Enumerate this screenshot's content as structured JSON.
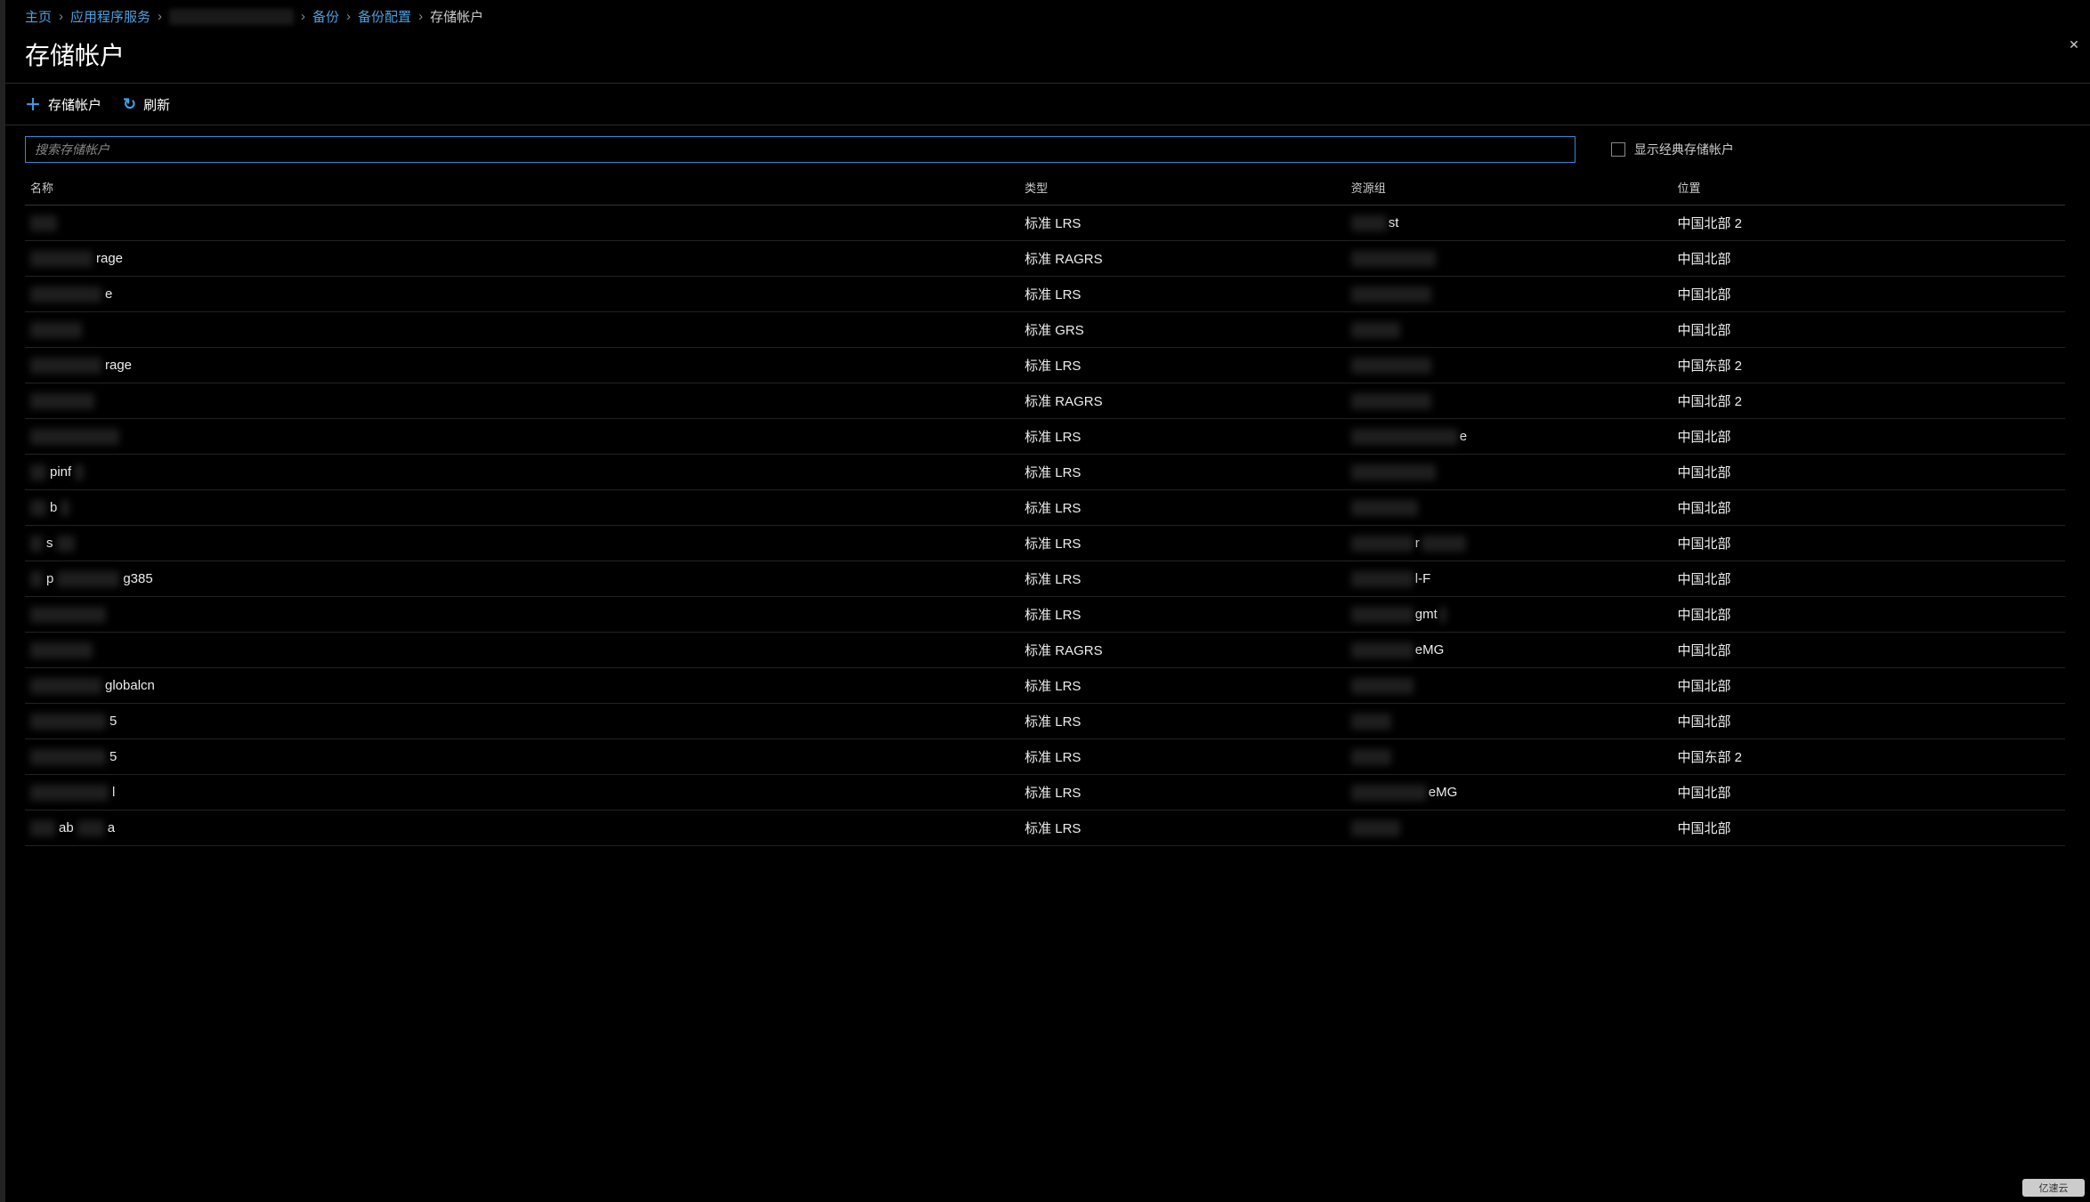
{
  "breadcrumb": {
    "home": "主页",
    "app_services": "应用程序服务",
    "backup": "备份",
    "backup_config": "备份配置",
    "storage_account": "存储帐户"
  },
  "page_title": "存储帐户",
  "close_label": "✕",
  "toolbar": {
    "add_storage": "存储帐户",
    "refresh": "刷新"
  },
  "search": {
    "placeholder": "搜索存储帐户"
  },
  "checkbox": {
    "show_classic": "显示经典存储帐户"
  },
  "columns": {
    "name": "名称",
    "type": "类型",
    "resource_group": "资源组",
    "location": "位置"
  },
  "rows": [
    {
      "name_suffix": "",
      "blur_w": 30,
      "type": "标准 LRS",
      "group_suffix": "st",
      "group_blur_w": 40,
      "location": "中国北部 2"
    },
    {
      "name_suffix": "rage",
      "blur_w": 70,
      "type": "标准 RAGRS",
      "group_suffix": "",
      "group_blur_w": 95,
      "location": "中国北部"
    },
    {
      "name_suffix": "",
      "blur_w": 80,
      "name_extra": "e",
      "type": "标准 LRS",
      "group_suffix": "",
      "group_blur_w": 90,
      "location": "中国北部"
    },
    {
      "name_suffix": "",
      "blur_w": 58,
      "type": "标准 GRS",
      "group_suffix": "",
      "group_blur_w": 55,
      "location": "中国北部"
    },
    {
      "name_suffix": "rage",
      "blur_w": 80,
      "type": "标准 LRS",
      "group_suffix": "",
      "group_blur_w": 90,
      "location": "中国东部 2"
    },
    {
      "name_suffix": "",
      "blur_w": 72,
      "type": "标准 RAGRS",
      "group_suffix": "",
      "group_blur_w": 90,
      "location": "中国北部 2"
    },
    {
      "name_suffix": "",
      "blur_w": 100,
      "name_prefix": "",
      "type": "标准 LRS",
      "group_suffix": "e",
      "group_blur_w": 120,
      "location": "中国北部"
    },
    {
      "name_suffix": "",
      "name_prefix": "pinf",
      "blur_w": 18,
      "blur_after_w": 10,
      "type": "标准 LRS",
      "group_suffix": "",
      "group_blur_w": 95,
      "location": "中国北部"
    },
    {
      "name_suffix": "",
      "name_prefix": "b",
      "blur_w": 18,
      "blur_after_w": 10,
      "type": "标准 LRS",
      "group_suffix": "",
      "group_blur_w": 75,
      "location": "中国北部"
    },
    {
      "name_suffix": "",
      "name_prefix": "s",
      "blur_w": 14,
      "blur_after_w": 20,
      "type": "标准 LRS",
      "group_suffix": "r",
      "group_blur_w": 70,
      "group_blur_after_w": 50,
      "location": "中国北部"
    },
    {
      "name_suffix": "g385",
      "name_prefix": "p",
      "blur_w": 14,
      "blur_mid_w": 70,
      "type": "标准 LRS",
      "group_suffix": "l-F",
      "group_blur_w": 70,
      "location": "中国北部"
    },
    {
      "name_suffix": "",
      "blur_w": 85,
      "type": "标准 LRS",
      "group_suffix": "gmt",
      "group_blur_w": 70,
      "group_blur_after_w": 8,
      "location": "中国北部"
    },
    {
      "name_suffix": "",
      "blur_w": 70,
      "type": "标准 RAGRS",
      "group_suffix": "eMG",
      "group_blur_w": 70,
      "location": "中国北部"
    },
    {
      "name_suffix": "globalcn",
      "blur_w": 80,
      "type": "标准 LRS",
      "group_suffix": "",
      "group_blur_w": 70,
      "location": "中国北部"
    },
    {
      "name_suffix": "5",
      "blur_w": 85,
      "type": "标准 LRS",
      "group_suffix": "",
      "group_blur_w": 45,
      "location": "中国北部"
    },
    {
      "name_suffix": "5",
      "blur_w": 85,
      "type": "标准 LRS",
      "group_suffix": "",
      "group_blur_w": 45,
      "location": "中国东部 2"
    },
    {
      "name_suffix": "l",
      "blur_w": 88,
      "type": "标准 LRS",
      "group_suffix": "eMG",
      "group_blur_w": 85,
      "location": "中国北部"
    },
    {
      "name_suffix": "a",
      "name_prefix": "ab",
      "blur_w": 28,
      "blur_mid_w": 30,
      "type": "标准 LRS",
      "group_suffix": "",
      "group_blur_w": 55,
      "location": "中国北部"
    }
  ],
  "watermark": "亿速云"
}
